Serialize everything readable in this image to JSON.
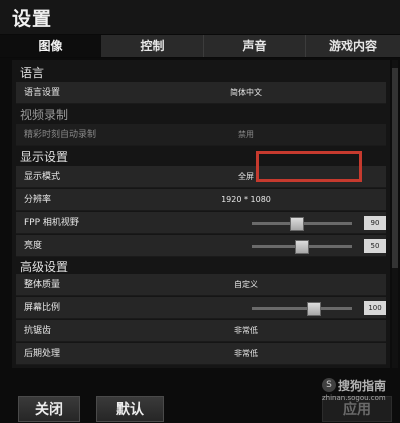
{
  "window": {
    "title": "设置"
  },
  "tabs": [
    {
      "label": "图像",
      "active": true
    },
    {
      "label": "控制",
      "active": false
    },
    {
      "label": "声音",
      "active": false
    },
    {
      "label": "游戏内容",
      "active": false
    }
  ],
  "sections": {
    "language": "语言",
    "video_recording": "视频录制",
    "display": "显示设置",
    "advanced": "高级设置"
  },
  "settings": {
    "language": {
      "label": "语言设置",
      "value": "简体中文"
    },
    "auto_record": {
      "label": "精彩时刻自动录制",
      "value": "禁用"
    },
    "display_mode": {
      "label": "显示模式",
      "value": "全屏"
    },
    "resolution": {
      "label": "分辨率",
      "value": "1920 * 1080"
    },
    "fpp_fov": {
      "label": "FPP 相机视野",
      "value": "90",
      "level": 0.45
    },
    "brightness": {
      "label": "亮度",
      "value": "50",
      "level": 0.5
    },
    "overall_quality": {
      "label": "整体质量",
      "value": "自定义"
    },
    "screen_scale": {
      "label": "屏幕比例",
      "value": "100",
      "level": 0.62
    },
    "anti_aliasing": {
      "label": "抗锯齿",
      "value": "非常低"
    },
    "post_processing": {
      "label": "后期处理",
      "value": "非常低"
    }
  },
  "buttons": {
    "close": "关闭",
    "default": "默认",
    "apply": "应用"
  },
  "watermark": {
    "brand": "搜狗指南",
    "url": "zhinan.sogou.com"
  },
  "colors": {
    "highlight": "#c63a2e",
    "background": "#0c0c0c",
    "row": "#262626"
  }
}
